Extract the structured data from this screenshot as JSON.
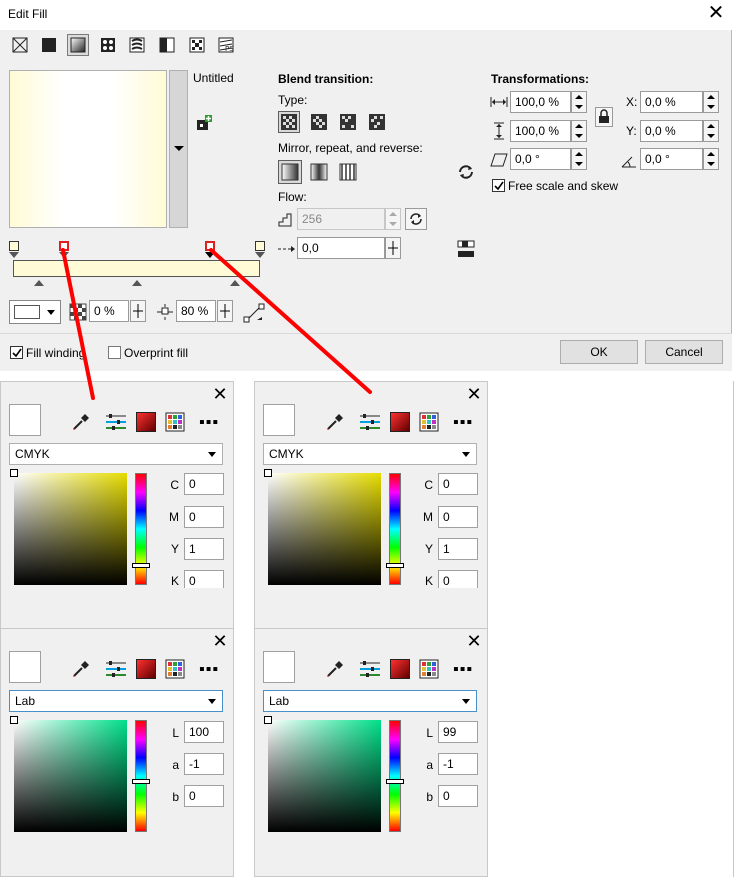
{
  "dialog": {
    "title": "Edit Fill",
    "preset_name": "Untitled",
    "blend": {
      "heading": "Blend transition:",
      "type_label": "Type:",
      "mirror_label": "Mirror, repeat, and reverse:",
      "flow_label": "Flow:",
      "steps_value": "256",
      "acceleration_value": "0,0"
    },
    "transform": {
      "heading": "Transformations:",
      "width_value": "100,0 %",
      "height_value": "100,0 %",
      "skew_value": "0,0 °",
      "x_label": "X:",
      "x_value": "0,0 %",
      "y_label": "Y:",
      "y_value": "0,0 %",
      "rotate_value": "0,0 °",
      "free_scale_label": "Free scale and skew"
    },
    "node": {
      "transparency_value": "0 %",
      "position_value": "80 %"
    },
    "fill_winding_label": "Fill winding",
    "overprint_label": "Overprint fill",
    "ok_label": "OK",
    "cancel_label": "Cancel"
  },
  "panels": [
    {
      "model": "CMYK",
      "channels": [
        {
          "label": "C",
          "value": "0"
        },
        {
          "label": "M",
          "value": "0"
        },
        {
          "label": "Y",
          "value": "1"
        },
        {
          "label": "K",
          "value": "0"
        }
      ]
    },
    {
      "model": "CMYK",
      "channels": [
        {
          "label": "C",
          "value": "0"
        },
        {
          "label": "M",
          "value": "0"
        },
        {
          "label": "Y",
          "value": "1"
        },
        {
          "label": "K",
          "value": "0"
        }
      ]
    },
    {
      "model": "Lab",
      "channels": [
        {
          "label": "L",
          "value": "100"
        },
        {
          "label": "a",
          "value": "-1"
        },
        {
          "label": "b",
          "value": "0"
        }
      ]
    },
    {
      "model": "Lab",
      "channels": [
        {
          "label": "L",
          "value": "99"
        },
        {
          "label": "a",
          "value": "-1"
        },
        {
          "label": "b",
          "value": "0"
        }
      ]
    }
  ],
  "colors": {
    "annotation_arrow": "#ff0000",
    "gradient_end": "#fffbd6",
    "selected_node": "#e02020"
  }
}
